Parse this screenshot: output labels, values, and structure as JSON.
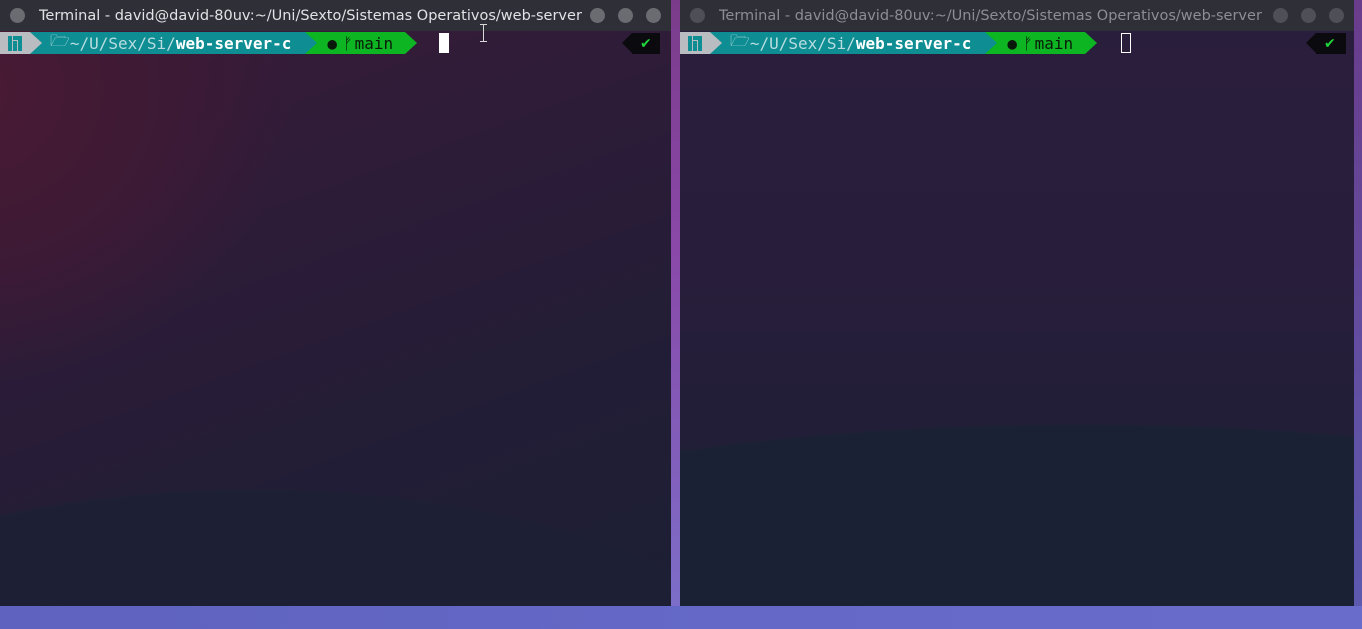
{
  "windows": [
    {
      "title": "Terminal - david@david-80uv:~/Uni/Sexto/Sistemas Operativos/web-server",
      "focused": true,
      "prompt": {
        "path_prefix": "~/U/Sex/Si/",
        "path_current": "web-server-c",
        "git_branch": "main",
        "status": "✔"
      }
    },
    {
      "title": "Terminal - david@david-80uv:~/Uni/Sexto/Sistemas Operativos/web-server",
      "focused": false,
      "prompt": {
        "path_prefix": "~/U/Sex/Si/",
        "path_current": "web-server-c",
        "git_branch": "main",
        "status": "✔"
      }
    }
  ],
  "icons": {
    "os": "manjaro-logo-icon",
    "folder": "folder-open-icon",
    "github": "github-icon",
    "branch": "git-branch-icon",
    "status": "checkmark-icon"
  },
  "colors": {
    "path_segment": "#0e8d93",
    "git_segment": "#0eb522",
    "os_segment": "#b9bcc0",
    "status_ok": "#1fd33a"
  }
}
